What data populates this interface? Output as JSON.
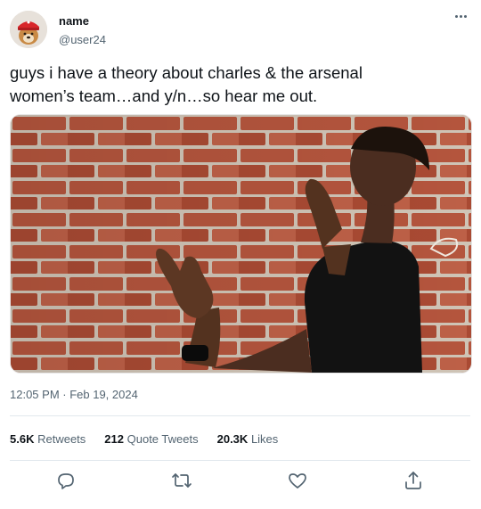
{
  "tweet": {
    "author_name": "name",
    "author_handle": "@user24",
    "text": "guys i have a theory about charles & the arsenal\nwomen’s team…and y/n…so hear me out.",
    "timestamp": "12:05 PM · Feb 19, 2024",
    "image_description": "",
    "stats": {
      "retweets_count": "5.6K",
      "retweets_label": "Retweets",
      "quotes_count": "212",
      "quotes_label": "Quote Tweets",
      "likes_count": "20.3K",
      "likes_label": "Likes"
    }
  },
  "icons": {
    "more": "more-icon",
    "reply": "reply-icon",
    "retweet": "retweet-icon",
    "like": "heart-icon",
    "share": "share-icon"
  },
  "colors": {
    "text": "#0f1419",
    "secondary": "#536471",
    "divider": "#e1e8ed",
    "brick": "#b65a42"
  }
}
